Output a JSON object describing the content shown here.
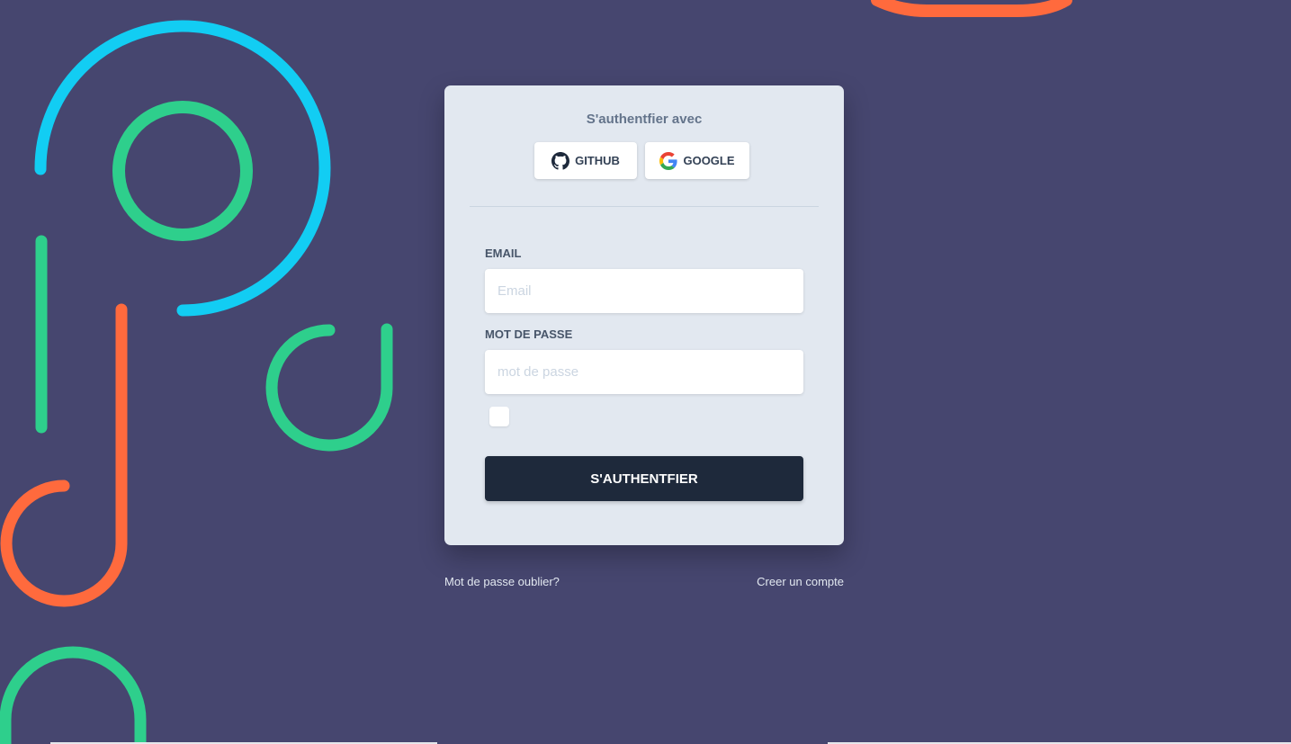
{
  "colors": {
    "background": "#46466f",
    "card": "#e2e8f0",
    "accent_blue": "#12cdf3",
    "accent_green": "#2ecf8c",
    "accent_orange": "#ff6a3d",
    "submit": "#1e293b"
  },
  "login": {
    "title": "S'authentfier avec",
    "social": [
      {
        "label": "GITHUB",
        "icon": "github-icon"
      },
      {
        "label": "GOOGLE",
        "icon": "google-icon"
      }
    ],
    "email": {
      "label": "EMAIL",
      "placeholder": "Email",
      "value": ""
    },
    "password": {
      "label": "MOT DE PASSE",
      "placeholder": "mot de passe",
      "value": ""
    },
    "remember": {
      "checked": false
    },
    "submit_label": "S'AUTHENTFIER"
  },
  "links": {
    "forgot": "Mot de passe oublier?",
    "create": "Creer un compte"
  }
}
